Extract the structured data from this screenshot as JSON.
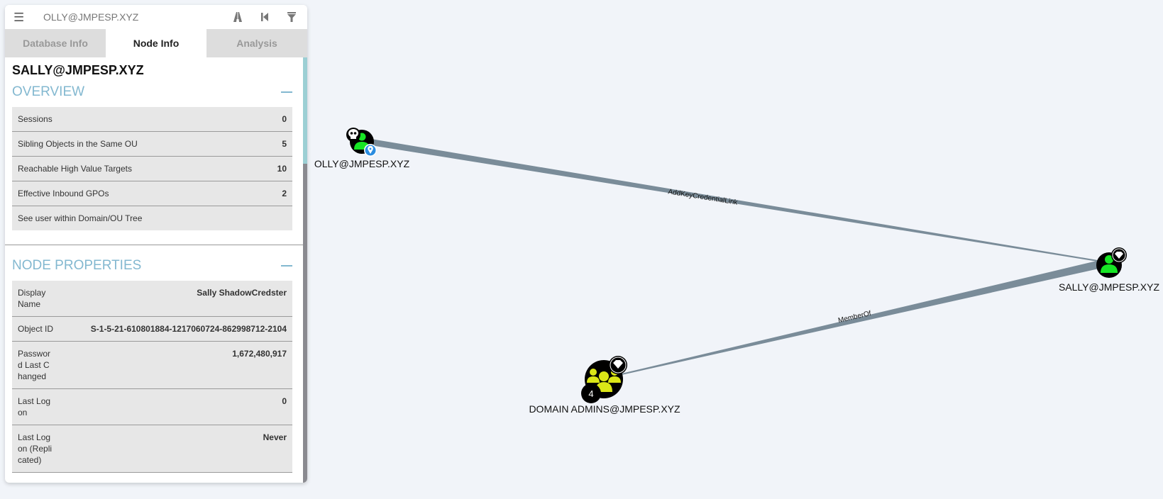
{
  "search": {
    "value": "OLLY@JMPESP.XYZ"
  },
  "toolbar": {
    "icons": [
      "pathfinding-icon",
      "back-icon",
      "filter-icon"
    ]
  },
  "tabs": [
    {
      "label": "Database Info",
      "active": false
    },
    {
      "label": "Node Info",
      "active": true
    },
    {
      "label": "Analysis",
      "active": false
    }
  ],
  "node": {
    "title": "SALLY@JMPESP.XYZ",
    "overview": {
      "title": "OVERVIEW",
      "rows": [
        {
          "label": "Sessions",
          "value": "0"
        },
        {
          "label": "Sibling Objects in the Same OU",
          "value": "5"
        },
        {
          "label": "Reachable High Value Targets",
          "value": "10"
        },
        {
          "label": "Effective Inbound GPOs",
          "value": "2"
        },
        {
          "label": "See user within Domain/OU Tree",
          "value": ""
        }
      ]
    },
    "properties": {
      "title": "NODE PROPERTIES",
      "rows": [
        {
          "label": "Display Name",
          "value": "Sally ShadowCredster"
        },
        {
          "label": "Object ID",
          "value": "S-1-5-21-610801884-1217060724-862998712-2104"
        },
        {
          "label": "Password Last Changed",
          "value": "1,672,480,917"
        },
        {
          "label": "Last Logon",
          "value": "0"
        },
        {
          "label": "Last Logon (Replicated)",
          "value": "Never"
        }
      ]
    }
  },
  "graph": {
    "nodes": [
      {
        "id": "olly",
        "label": "OLLY@JMPESP.XYZ",
        "type": "user",
        "color": "#17e625",
        "badges": [
          "owned-skull",
          "start-marker"
        ]
      },
      {
        "id": "sally",
        "label": "SALLY@JMPESP.XYZ",
        "type": "user",
        "color": "#17e625",
        "badges": [
          "high-value-gem"
        ]
      },
      {
        "id": "da",
        "label": "DOMAIN ADMINS@JMPESP.XYZ",
        "type": "group",
        "color": "#dbe617",
        "badges": [
          "high-value-gem"
        ],
        "count": "4"
      }
    ],
    "edges": [
      {
        "from": "olly",
        "to": "sally",
        "label": "AddKeyCredentialLink"
      },
      {
        "from": "da",
        "to": "sally",
        "label": "MemberOf"
      }
    ],
    "edge_color": "#7a8c99"
  }
}
